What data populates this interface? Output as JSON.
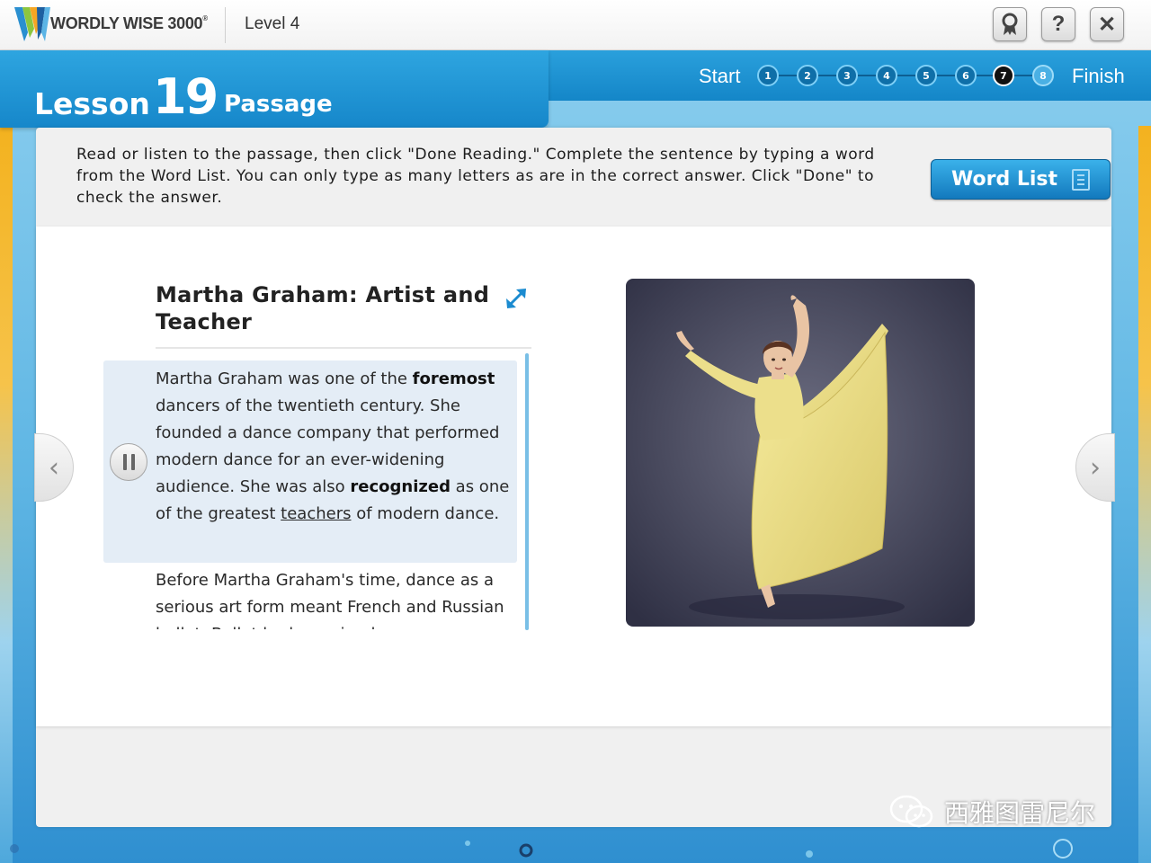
{
  "header": {
    "brand": "WORDLY WISE 3000",
    "brand_mark": "®",
    "level": "Level 4",
    "buttons": [
      {
        "icon": "award-icon"
      },
      {
        "icon": "help-icon",
        "label": "?"
      },
      {
        "icon": "close-icon",
        "label": "✕"
      }
    ]
  },
  "lesson": {
    "word": "Lesson",
    "number": "19",
    "section": "Passage"
  },
  "progress": {
    "start_label": "Start",
    "finish_label": "Finish",
    "steps": [
      "1",
      "2",
      "3",
      "4",
      "5",
      "6",
      "7",
      "8"
    ],
    "current_step": 7
  },
  "instructions": "Read or listen to the passage, then click \"Done Reading.\" Complete the sentence by typing a word from the Word List. You can only type as many letters as are in the correct answer. Click \"Done\" to check the answer.",
  "word_list_button": "Word List",
  "passage": {
    "title": "Martha Graham: Artist and Teacher",
    "para1": {
      "t1": "Martha Graham was one of the ",
      "b1": "foremost",
      "t2": " dancers of the twentieth century. She founded a dance company that performed modern dance for an ever-widening audience. She was also ",
      "b2": "recognized",
      "t3": " as one of the greatest ",
      "u1": "teachers",
      "t4": " of modern dance."
    },
    "para2": "Before Martha Graham's time, dance as a serious art form meant French and Russian ballet. Ballet had remained"
  },
  "nav": {
    "prev": "‹",
    "next": "›"
  },
  "watermark": "西雅图雷尼尔",
  "colors": {
    "brand_blue": "#1486c8",
    "button_blue": "#1379bd",
    "highlight": "#e4edf6"
  }
}
